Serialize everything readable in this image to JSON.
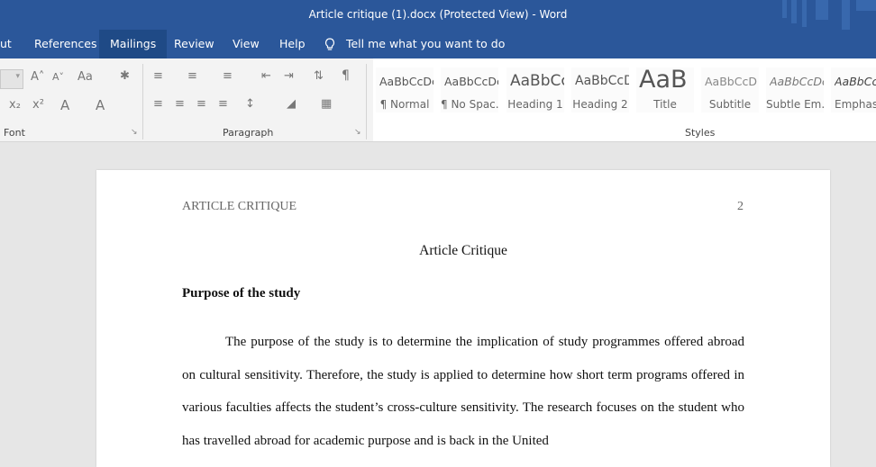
{
  "window": {
    "title": "Article critique (1).docx (Protected View)  -  Word"
  },
  "tabs": [
    {
      "label": "ut"
    },
    {
      "label": "References"
    },
    {
      "label": "Mailings",
      "active": true
    },
    {
      "label": "Review"
    },
    {
      "label": "View"
    },
    {
      "label": "Help"
    }
  ],
  "tell_me": {
    "label": "Tell me what you want to do"
  },
  "ribbon": {
    "groups": {
      "font": "Font",
      "paragraph": "Paragraph",
      "styles": "Styles"
    },
    "font_buttons": {
      "grow": "A˄",
      "shrink": "A˅",
      "change_case": "Aa",
      "subscript": "x₂",
      "superscript": "x²",
      "text_effects": "A",
      "font_color": "A"
    },
    "styles": [
      {
        "sample": "AaBbCcDc",
        "name": "¶ Normal"
      },
      {
        "sample": "AaBbCcDc",
        "name": "¶ No Spac..."
      },
      {
        "sample": "AaBbCc",
        "name": "Heading 1"
      },
      {
        "sample": "AaBbCcD",
        "name": "Heading 2"
      },
      {
        "sample": "AaB",
        "name": "Title"
      },
      {
        "sample": "AaBbCcD",
        "name": "Subtitle"
      },
      {
        "sample": "AaBbCcDc",
        "name": "Subtle Em..."
      },
      {
        "sample": "AaBbCcDc",
        "name": "Emphas"
      }
    ]
  },
  "document": {
    "header_left": "ARTICLE CRITIQUE",
    "page_number": "2",
    "title": "Article Critique",
    "heading": "Purpose of the study",
    "paragraph": "The purpose of the study is to determine the implication of study programmes offered abroad on cultural sensitivity. Therefore, the study is applied to determine how short term programs offered in various faculties affects the student’s cross-culture sensitivity. The research focuses on the student who has travelled abroad for academic purpose and is back in the United"
  },
  "colors": {
    "ribbon_blue": "#2b579a",
    "active_tab": "#1f4a86",
    "ribbon_bg": "#f3f3f3",
    "canvas": "#e6e6e6"
  }
}
